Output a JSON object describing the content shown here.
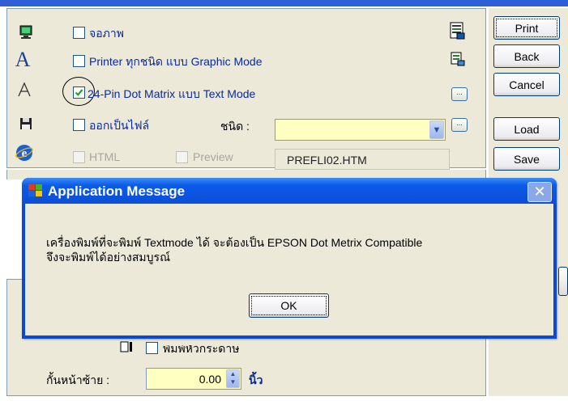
{
  "options": [
    {
      "icon": "monitor-icon",
      "label": "จอภาพ",
      "checked": false,
      "enabled": true
    },
    {
      "icon": "font-a-icon",
      "label": "Printer ทุกชนิด แบบ Graphic Mode",
      "checked": false,
      "enabled": true
    },
    {
      "icon": "font-outline-icon",
      "label": "24-Pin Dot Matrix แบบ Text Mode",
      "checked": true,
      "enabled": true
    },
    {
      "icon": "floppy-disk-icon",
      "label": "ออกเป็นไฟล์",
      "checked": false,
      "enabled": true
    },
    {
      "icon": "internet-explorer-icon",
      "label": "HTML",
      "checked": false,
      "enabled": false
    }
  ],
  "preview": {
    "label": "Preview",
    "checked": false,
    "enabled": false
  },
  "file_type": {
    "label": "ชนิด :",
    "value": ""
  },
  "filename": "PREFLI02.HTM",
  "right_buttons": [
    "Print",
    "Back",
    "Cancel",
    "Load",
    "Save"
  ],
  "lower": {
    "print_header_label": "พิมพ์หัวกระดาษ",
    "left_margin_label": "กั้นหน้าซ้าย :",
    "left_margin_value": "0.00",
    "left_margin_unit": "นิ้ว"
  },
  "dialog": {
    "title": "Application Message",
    "line1": "เครื่องพิมพ์ที่จะพิมพ์ Textmode ได้ จะต้องเป็น EPSON Dot Metrix Compatible",
    "line2": "จึงจะพิมพ์ได้อย่างสมบูรณ์",
    "ok_label": "OK",
    "close_symbol": "✕"
  },
  "colors": {
    "title_blue": "#0a48d8",
    "window_bg": "#ece9d8",
    "input_yellow": "#ffffc2"
  }
}
